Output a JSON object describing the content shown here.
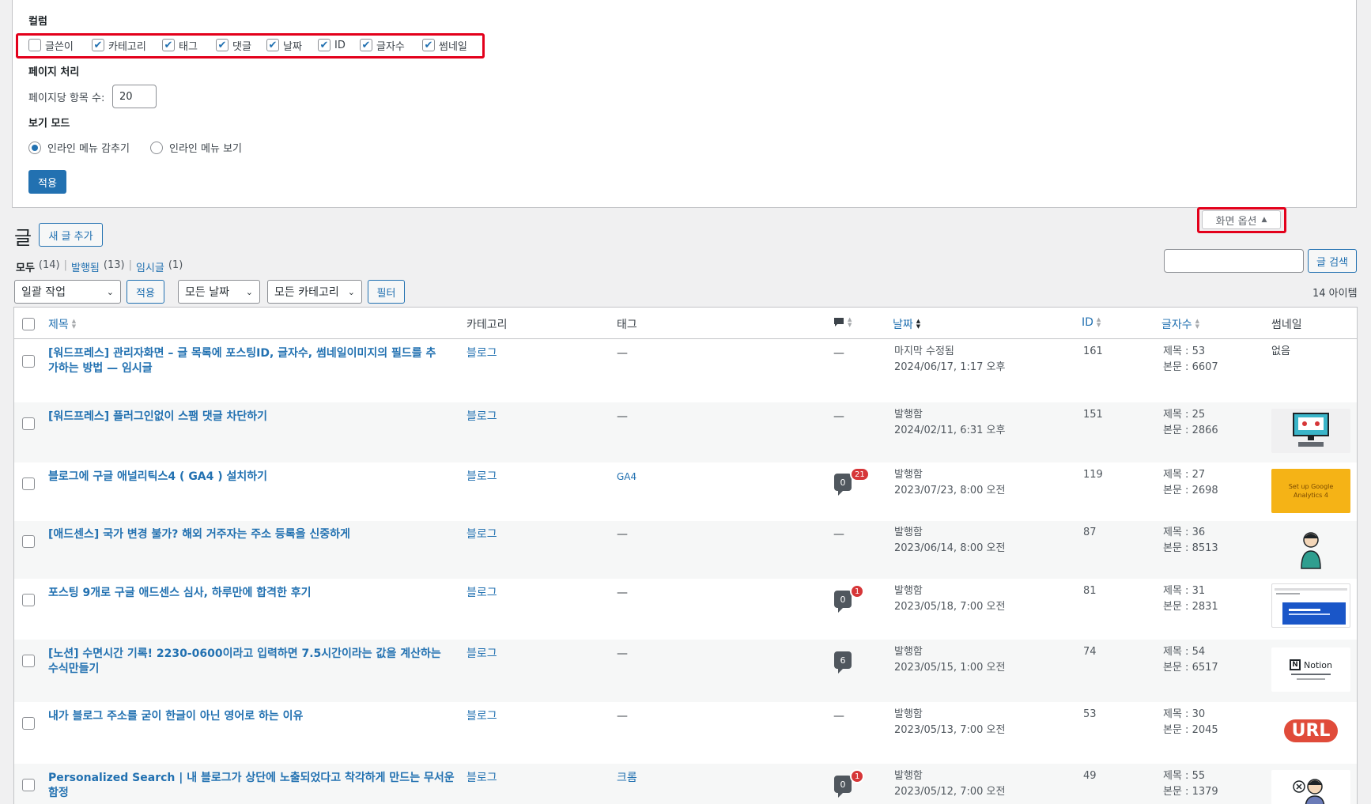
{
  "screen_options": {
    "columns_legend": "컬럼",
    "columns": [
      {
        "label": "글쓴이",
        "checked": false
      },
      {
        "label": "카테고리",
        "checked": true
      },
      {
        "label": "태그",
        "checked": true
      },
      {
        "label": "댓글",
        "checked": true
      },
      {
        "label": "날짜",
        "checked": true
      },
      {
        "label": "ID",
        "checked": true
      },
      {
        "label": "글자수",
        "checked": true
      },
      {
        "label": "썸네일",
        "checked": true
      }
    ],
    "pagination_legend": "페이지 처리",
    "per_page_label": "페이지당 항목 수:",
    "per_page_value": "20",
    "view_mode_legend": "보기 모드",
    "view_modes": [
      {
        "label": "인라인 메뉴 감추기",
        "selected": true
      },
      {
        "label": "인라인 메뉴 보기",
        "selected": false
      }
    ],
    "apply_label": "적용",
    "toggle_label": "화면 옵션",
    "toggle_arrow": "▲"
  },
  "page": {
    "title": "글",
    "add_new_label": "새 글 추가",
    "search_button": "글 검색",
    "search_value": "",
    "item_count": "14 아이템"
  },
  "subsubsub": {
    "all_label": "모두",
    "all_count": "(14)",
    "sep1": "|",
    "published_label": "발행됨",
    "published_count": "(13)",
    "sep2": "|",
    "draft_label": "임시글",
    "draft_count": "(1)"
  },
  "filters": {
    "bulk_action": "일괄 작업",
    "apply": "적용",
    "dates": "모든 날짜",
    "categories": "모든 카테고리",
    "filter": "필터"
  },
  "table": {
    "headers": {
      "title": "제목",
      "category": "카테고리",
      "tags": "태그",
      "date": "날짜",
      "id": "ID",
      "chars": "글자수",
      "thumbnail": "썸네일"
    },
    "rows": [
      {
        "title_line1": "[워드프레스] 관리자화면 – 글 목록에 포스팅ID, 글자수, 썸네일이미지의 필드를 추",
        "title_line2": "가하는 방법 — 임시글",
        "category": "블로그",
        "tags": "—",
        "comments": "—",
        "pending": "",
        "status": "마지막 수정됨",
        "date": "2024/06/17, 1:17 오후",
        "id": "161",
        "title_chars": "제목 : 53",
        "body_chars": "본문 : 6607",
        "thumbnail": "없음"
      },
      {
        "title_line1": "[워드프레스] 플러그인없이 스팸 댓글 차단하기",
        "title_line2": "",
        "category": "블로그",
        "tags": "—",
        "comments": "—",
        "pending": "",
        "status": "발행함",
        "date": "2024/02/11, 6:31 오후",
        "id": "151",
        "title_chars": "제목 : 25",
        "body_chars": "본문 : 2866",
        "thumbnail": ""
      },
      {
        "title_line1": "블로그에 구글 애널리틱스4 ( GA4 ) 설치하기",
        "title_line2": "",
        "category": "블로그",
        "tags": "GA4",
        "comments": "0",
        "pending": "21",
        "status": "발행함",
        "date": "2023/07/23, 8:00 오전",
        "id": "119",
        "title_chars": "제목 : 27",
        "body_chars": "본문 : 2698",
        "thumbnail": "Set up Google Analytics 4"
      },
      {
        "title_line1": "[애드센스] 국가 변경 불가? 해외 거주자는 주소 등록을 신중하게",
        "title_line2": "",
        "category": "블로그",
        "tags": "—",
        "comments": "—",
        "pending": "",
        "status": "발행함",
        "date": "2023/06/14, 8:00 오전",
        "id": "87",
        "title_chars": "제목 : 36",
        "body_chars": "본문 : 8513",
        "thumbnail": ""
      },
      {
        "title_line1": "포스팅 9개로 구글 애드센스 심사, 하루만에 합격한 후기",
        "title_line2": "",
        "category": "블로그",
        "tags": "—",
        "comments": "0",
        "pending": "1",
        "status": "발행함",
        "date": "2023/05/18, 7:00 오전",
        "id": "81",
        "title_chars": "제목 : 31",
        "body_chars": "본문 : 2831",
        "thumbnail": ""
      },
      {
        "title_line1": "[노션] 수면시간 기록! 2230-0600이라고 입력하면 7.5시간이라는 값을 계산하는",
        "title_line2": "수식만들기",
        "category": "블로그",
        "tags": "—",
        "comments": "6",
        "pending": "",
        "status": "발행함",
        "date": "2023/05/15, 1:00 오전",
        "id": "74",
        "title_chars": "제목 : 54",
        "body_chars": "본문 : 6517",
        "thumbnail": "Notion"
      },
      {
        "title_line1": "내가 블로그 주소를 굳이 한글이 아닌 영어로 하는 이유",
        "title_line2": "",
        "category": "블로그",
        "tags": "—",
        "comments": "—",
        "pending": "",
        "status": "발행함",
        "date": "2023/05/13, 7:00 오전",
        "id": "53",
        "title_chars": "제목 : 30",
        "body_chars": "본문 : 2045",
        "thumbnail": "URL"
      },
      {
        "title_line1": "Personalized Search | 내 블로그가 상단에 노출되었다고 착각하게 만드는 무서운",
        "title_line2": "함정",
        "category": "블로그",
        "tags": "크롬",
        "comments": "0",
        "pending": "1",
        "status": "발행함",
        "date": "2023/05/12, 7:00 오전",
        "id": "49",
        "title_chars": "제목 : 55",
        "body_chars": "본문 : 1379",
        "thumbnail": ""
      }
    ]
  },
  "colors": {
    "accent": "#2271b1",
    "highlight_box": "#e3001b",
    "pending_badge": "#d63638"
  }
}
